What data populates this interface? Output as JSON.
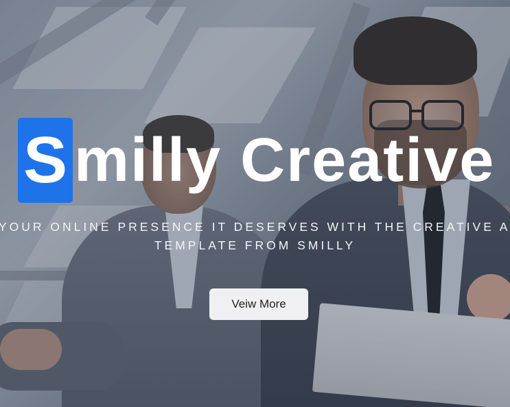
{
  "hero": {
    "brand_initial": "S",
    "brand_rest": "milly Creative",
    "tagline_line1": "YOUR ONLINE PRESENCE IT DESERVES WITH THE CREATIVE AG",
    "tagline_line2": "TEMPLATE FROM SMILLY",
    "cta_label": "Veiw More"
  },
  "colors": {
    "accent": "#1e73e8",
    "text": "#ffffff",
    "button_bg": "#f0f0f2"
  }
}
